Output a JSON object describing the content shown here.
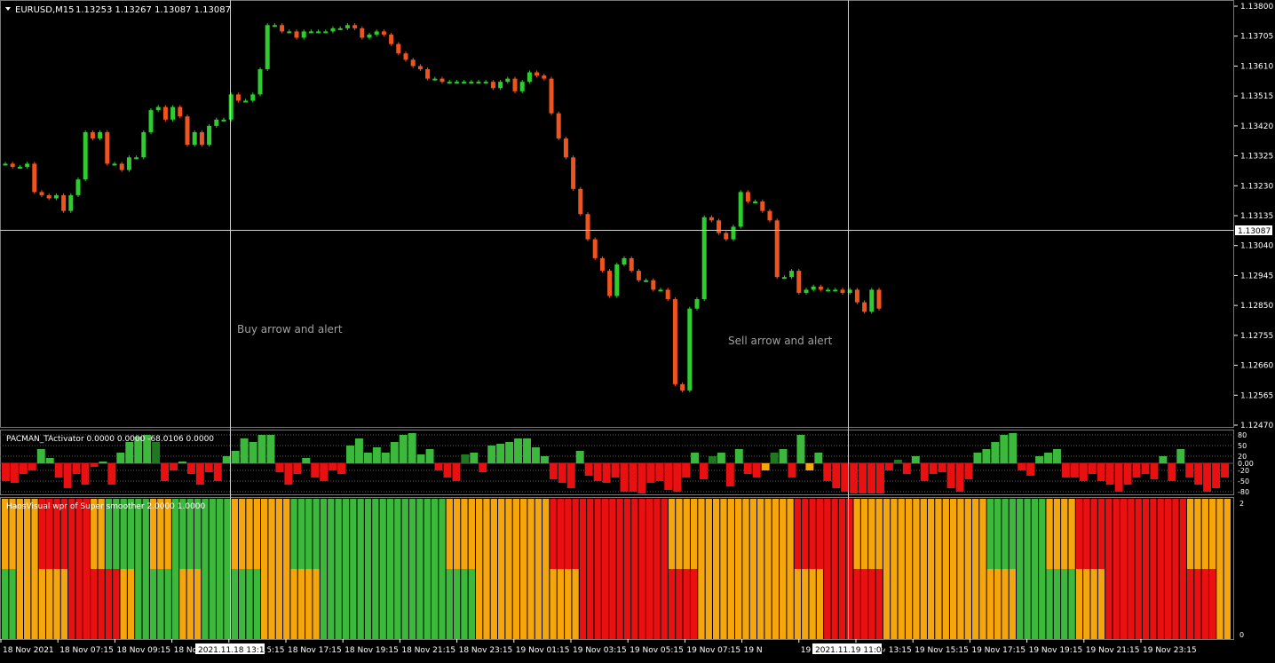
{
  "header": {
    "symbol": "EURUSD,M15",
    "ohlc": "1.13253 1.13267 1.13087 1.13087"
  },
  "colors": {
    "background": "#000000",
    "bull": "#2ecc2e",
    "bear": "#f0541e",
    "green_bar": "#3cb83c",
    "dark_green_bar": "#1f7a1f",
    "red_bar": "#e81010",
    "orange_bar": "#f5a60c",
    "grid": "#5a5a5a",
    "crosshair": "#d0d0d0",
    "axis_text": "#ffffff",
    "annotation_text": "#a0a0a0"
  },
  "annotations": {
    "buy": "Buy arrow and alert",
    "sell": "Sell arrow and alert"
  },
  "price_axis": {
    "labels": [
      "1.13800",
      "1.13705",
      "1.13610",
      "1.13515",
      "1.13420",
      "1.13325",
      "1.13230",
      "1.13135",
      "1.13040",
      "1.12945",
      "1.12850",
      "1.12755",
      "1.12660",
      "1.12565",
      "1.12470"
    ],
    "current_price": "1.13087"
  },
  "indicator1": {
    "title": "PACMAN_TActivator 0.0000 0.0000 -68.0106 0.0000",
    "levels": [
      "80",
      "50",
      "20",
      "0.00",
      "-20",
      "-50",
      "-80"
    ]
  },
  "indicator2": {
    "title": "HaosVisual wpr of Super smoother 2.0000 1.0000",
    "levels": [
      "2",
      "0"
    ]
  },
  "time_axis": {
    "labels": [
      "18 Nov 2021",
      "18 Nov 07:15",
      "18 Nov 09:15",
      "18 No",
      "18 Nov 15:15",
      "18 Nov 17:15",
      "18 Nov 19:15",
      "18 Nov 21:15",
      "18 Nov 23:15",
      "19 Nov 01:15",
      "19 Nov 03:15",
      "19 Nov 05:15",
      "19 Nov 07:15",
      "19 N",
      "19 Nov 11:15",
      "19 Nov 13:15",
      "19 Nov 15:15",
      "19 Nov 17:15",
      "19 Nov 19:15",
      "19 Nov 21:15",
      "19 Nov 23:15"
    ],
    "crosshair_labels": [
      "2021.11.18 13:15",
      "2021.11.19 11:00"
    ]
  },
  "chart_data": [
    {
      "type": "candlestick",
      "title": "EURUSD,M15",
      "timeframe": "M15",
      "ylim": [
        1.1247,
        1.138
      ],
      "x_start": "2021-11-18",
      "x_end": "19 Nov 23:15",
      "close_series": [
        1.133,
        1.1329,
        1.1329,
        1.133,
        1.1321,
        1.132,
        1.1319,
        1.132,
        1.1315,
        1.132,
        1.1325,
        1.134,
        1.1338,
        1.134,
        1.133,
        1.133,
        1.1328,
        1.1332,
        1.1332,
        1.134,
        1.1347,
        1.1348,
        1.1344,
        1.1348,
        1.1345,
        1.1336,
        1.134,
        1.1336,
        1.1342,
        1.1344,
        1.1344,
        1.1352,
        1.135,
        1.135,
        1.1352,
        1.136,
        1.1374,
        1.1374,
        1.1372,
        1.1372,
        1.137,
        1.1372,
        1.1372,
        1.1372,
        1.1372,
        1.1373,
        1.1373,
        1.1374,
        1.1373,
        1.137,
        1.1371,
        1.1372,
        1.1371,
        1.1368,
        1.1365,
        1.1363,
        1.1361,
        1.136,
        1.1357,
        1.1357,
        1.1356,
        1.1356,
        1.1356,
        1.1356,
        1.1356,
        1.1356,
        1.1356,
        1.1354,
        1.1356,
        1.1357,
        1.1353,
        1.1356,
        1.1359,
        1.1358,
        1.1357,
        1.1346,
        1.1338,
        1.1332,
        1.1322,
        1.1314,
        1.1306,
        1.13,
        1.1296,
        1.1288,
        1.1298,
        1.13,
        1.1296,
        1.1293,
        1.1293,
        1.129,
        1.129,
        1.1287,
        1.126,
        1.1258,
        1.1284,
        1.1287,
        1.1313,
        1.1312,
        1.1308,
        1.1306,
        1.131,
        1.1321,
        1.1318,
        1.1318,
        1.1315,
        1.1312,
        1.1294,
        1.1294,
        1.1296,
        1.1289,
        1.129,
        1.1291,
        1.129,
        1.129,
        1.129,
        1.1289,
        1.129,
        1.1286,
        1.1283,
        1.129,
        1.1284
      ],
      "current_price": 1.13087
    },
    {
      "type": "bar",
      "title": "PACMAN_TActivator 0.0000 0.0000 -68.0106 0.0000",
      "ylim": [
        -80,
        80
      ],
      "levels": [
        80,
        50,
        20,
        0,
        -20,
        -50,
        -80
      ],
      "values": [
        -50,
        -55,
        -30,
        -20,
        40,
        15,
        -40,
        -70,
        -30,
        -60,
        -10,
        5,
        -60,
        30,
        60,
        75,
        80,
        60,
        -50,
        -20,
        5,
        -30,
        -60,
        -25,
        -50,
        20,
        35,
        70,
        60,
        80,
        80,
        -25,
        -60,
        -30,
        15,
        -40,
        -50,
        -20,
        -30,
        50,
        70,
        30,
        45,
        30,
        60,
        80,
        85,
        25,
        40,
        -20,
        -40,
        -50,
        25,
        30,
        -25,
        50,
        55,
        60,
        70,
        70,
        45,
        20,
        -45,
        -55,
        -70,
        35,
        -35,
        -50,
        -55,
        -40,
        -80,
        -80,
        -85,
        -55,
        -50,
        -75,
        -80,
        -40,
        30,
        -45,
        20,
        30,
        -65,
        40,
        -30,
        -40,
        -20,
        30,
        40,
        -40,
        80,
        -20,
        30,
        -50,
        -70,
        -80,
        -85,
        -85,
        -85,
        -85,
        -20,
        10,
        -30,
        20,
        -50,
        -30,
        -25,
        -70,
        -80,
        -45,
        30,
        40,
        60,
        80,
        85,
        -20,
        -35,
        20,
        30,
        40,
        -40,
        -40,
        -50,
        -30,
        -50,
        -60,
        -80,
        -60,
        -40,
        -30,
        -45,
        20,
        -50,
        40,
        -40,
        -60,
        -80,
        -70,
        -40
      ]
    },
    {
      "type": "bar",
      "title": "HaosVisual wpr of Super smoother 2.0000 1.0000",
      "ylim": [
        0,
        2
      ],
      "levels": [
        2,
        0
      ],
      "states": [
        "g",
        "g",
        "o",
        "o",
        "o",
        "o",
        "o",
        "o",
        "o",
        "r",
        "r",
        "r",
        "r",
        "r",
        "r",
        "r",
        "o",
        "o",
        "g",
        "g",
        "g",
        "g",
        "g",
        "g",
        "o",
        "o",
        "o",
        "g",
        "g",
        "g",
        "g",
        "g",
        "g",
        "g",
        "g",
        "o",
        "o",
        "o",
        "o",
        "o",
        "o",
        "o",
        "o",
        "g",
        "g",
        "g",
        "g",
        "g",
        "g",
        "g",
        "g",
        "g",
        "g",
        "g",
        "g",
        "g",
        "g",
        "g",
        "g",
        "g",
        "g",
        "g",
        "g",
        "g",
        "o",
        "o",
        "o",
        "o",
        "o",
        "o",
        "o",
        "o",
        "o",
        "o",
        "o",
        "o",
        "o",
        "o",
        "r",
        "r",
        "r",
        "r",
        "r",
        "r",
        "r",
        "r",
        "r",
        "r",
        "r",
        "r",
        "r",
        "r",
        "r",
        "r",
        "o",
        "o",
        "o",
        "o",
        "o",
        "o",
        "o",
        "o",
        "o",
        "o",
        "o",
        "o",
        "o",
        "o",
        "o",
        "o",
        "o",
        "r",
        "r",
        "r",
        "r",
        "r",
        "r",
        "r",
        "r",
        "o",
        "o",
        "o",
        "o",
        "o",
        "o",
        "o",
        "o",
        "o",
        "o",
        "o",
        "o",
        "o",
        "o",
        "o",
        "o",
        "o",
        "o",
        "g",
        "g",
        "g",
        "g",
        "g",
        "g",
        "g",
        "g",
        "o",
        "o",
        "o",
        "o",
        "r",
        "r",
        "r",
        "r",
        "r",
        "r",
        "r",
        "r",
        "r",
        "r",
        "r",
        "r",
        "r",
        "r",
        "r",
        "o",
        "o"
      ]
    }
  ]
}
